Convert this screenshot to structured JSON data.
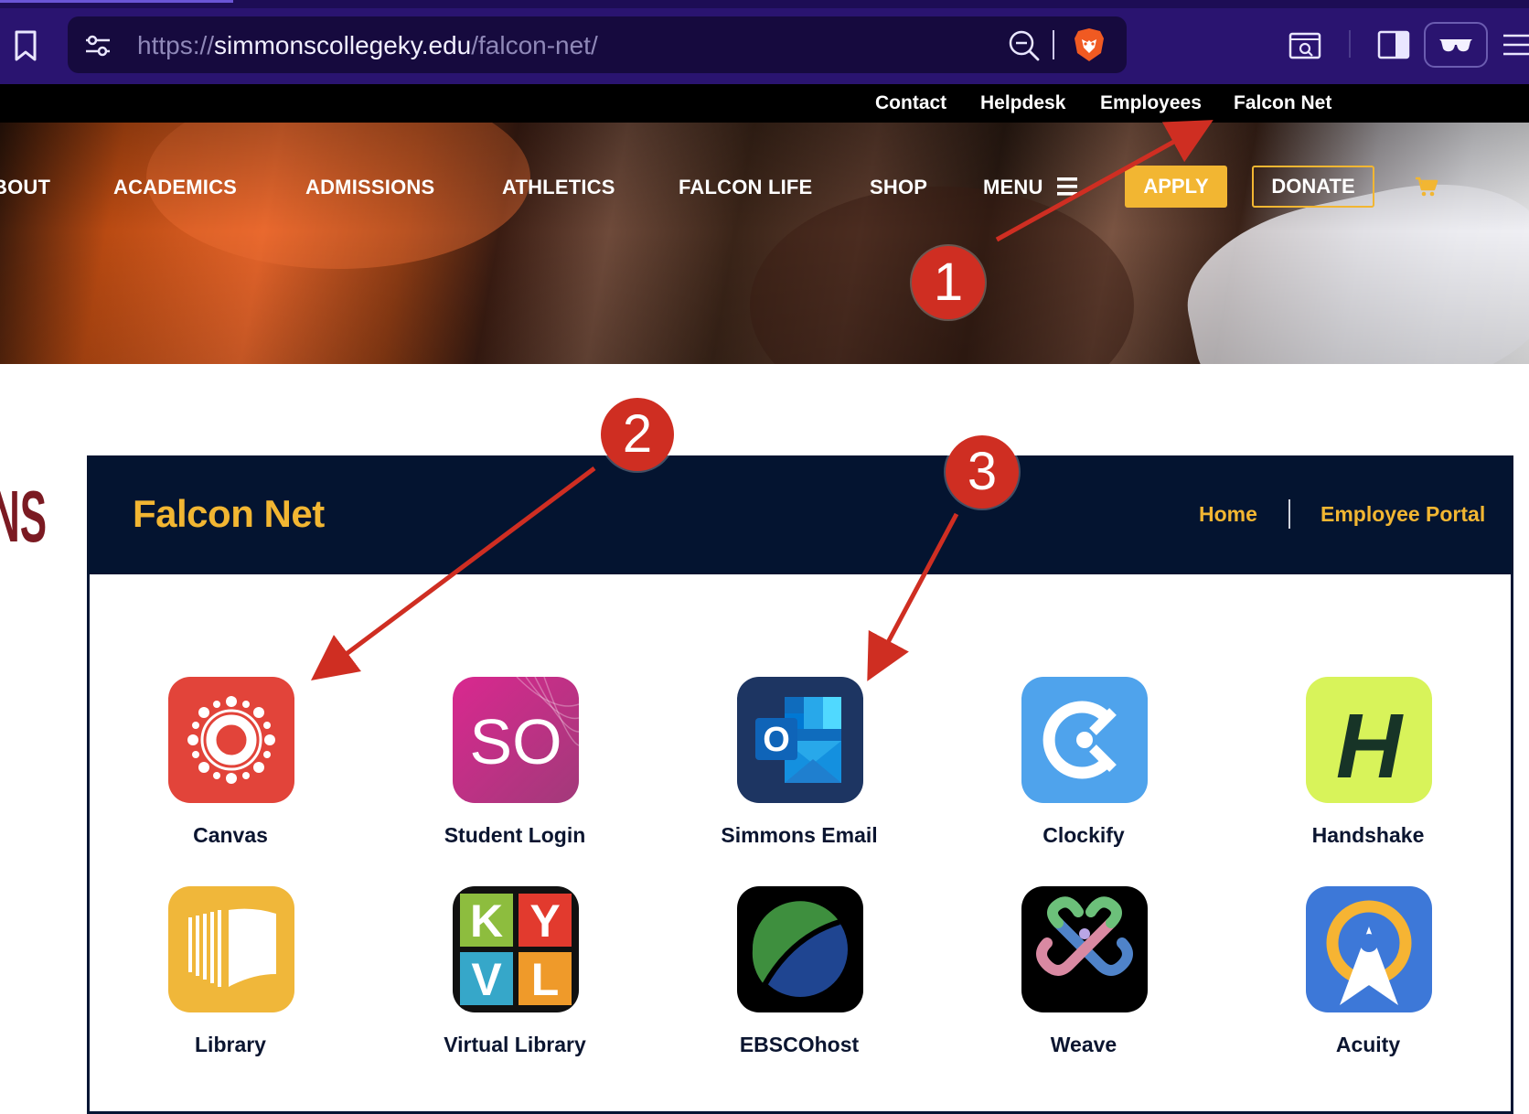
{
  "browser": {
    "url_scheme": "https://",
    "url_host": "simmonscollegeky.edu",
    "url_path": "/falcon-net/",
    "colors": {
      "toolbar": "#2a1470",
      "urlbar": "#160a3e"
    },
    "icons": [
      "bookmark-icon",
      "site-settings-icon",
      "zoom-icon",
      "brave-shields-icon",
      "screenshot-icon",
      "sidebar-icon",
      "reader-mode-icon",
      "hamburger-icon"
    ]
  },
  "utility_nav": [
    {
      "label": "Contact"
    },
    {
      "label": "Helpdesk"
    },
    {
      "label": "Employees"
    },
    {
      "label": "Falcon Net"
    }
  ],
  "main_nav": {
    "items": [
      {
        "label": "BOUT"
      },
      {
        "label": "ACADEMICS"
      },
      {
        "label": "ADMISSIONS"
      },
      {
        "label": "ATHLETICS"
      },
      {
        "label": "FALCON LIFE"
      },
      {
        "label": "SHOP"
      },
      {
        "label": "MENU"
      }
    ],
    "apply_label": "APPLY",
    "donate_label": "DONATE",
    "accent_color": "#f2b632"
  },
  "left_fragment": "NS",
  "falcon_net": {
    "title": "Falcon Net",
    "links": [
      {
        "label": "Home"
      },
      {
        "label": "Employee Portal"
      }
    ],
    "colors": {
      "header": "#041430",
      "accent": "#f2b632"
    },
    "apps": [
      {
        "label": "Canvas",
        "icon": "canvas-icon"
      },
      {
        "label": "Student Login",
        "icon": "student-login-icon",
        "icon_text": "SO"
      },
      {
        "label": "Simmons Email",
        "icon": "outlook-icon",
        "icon_text": "O"
      },
      {
        "label": "Clockify",
        "icon": "clockify-icon"
      },
      {
        "label": "Handshake",
        "icon": "handshake-icon",
        "icon_text": "H"
      },
      {
        "label": "Library",
        "icon": "library-icon"
      },
      {
        "label": "Virtual Library",
        "icon": "kyvl-icon",
        "icon_letters": [
          "K",
          "Y",
          "V",
          "L"
        ]
      },
      {
        "label": "EBSCOhost",
        "icon": "ebscohost-icon"
      },
      {
        "label": "Weave",
        "icon": "weave-icon"
      },
      {
        "label": "Acuity",
        "icon": "acuity-icon"
      }
    ]
  },
  "annotations": [
    {
      "number": "1",
      "target": "Falcon Net"
    },
    {
      "number": "2",
      "target": "Canvas"
    },
    {
      "number": "3",
      "target": "Simmons Email"
    }
  ],
  "annotation_color": "#cf2e22"
}
